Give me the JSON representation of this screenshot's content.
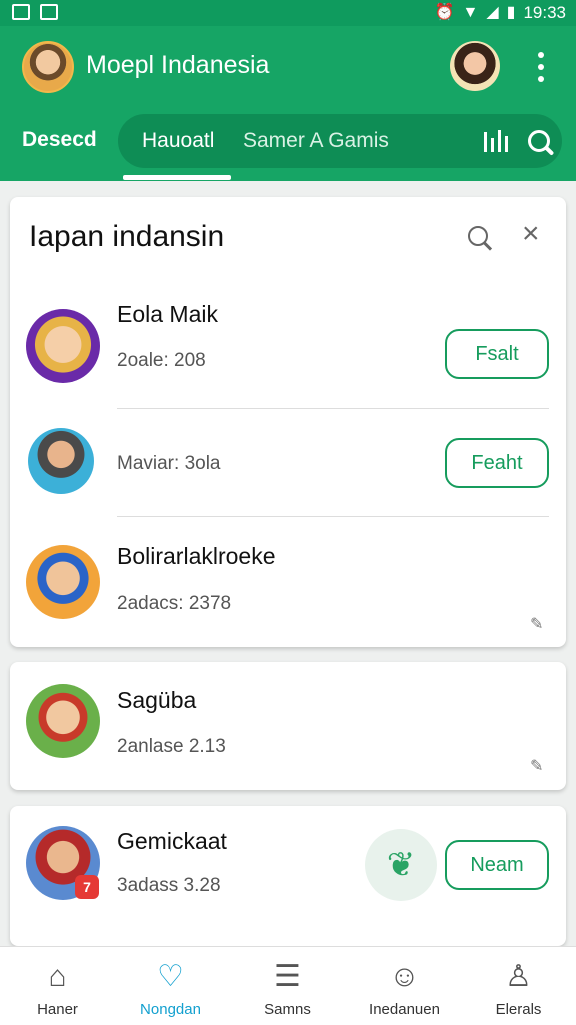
{
  "status_bar": {
    "time": "19:33"
  },
  "app_bar": {
    "title": "Moepl Indanesia",
    "tab_left": "Desecd",
    "tabs": [
      {
        "label": "Hauoatl"
      },
      {
        "label": "Samer A Gamis"
      }
    ]
  },
  "card": {
    "title": "Iapan indansin",
    "items": [
      {
        "name": "Eola Maik",
        "meta": "2oale: 208",
        "button": "Fsalt"
      },
      {
        "name": "",
        "meta": "Maviar: 3ola",
        "button": "Feaht"
      },
      {
        "name": "Bolirarlaklroeke",
        "meta": "2adacs: 2378",
        "button": ""
      }
    ]
  },
  "card2": {
    "name": "Sagüba",
    "meta": "2anlase 2.13"
  },
  "card3": {
    "name": "Gemickaat",
    "meta": "3adass 3.28",
    "badge": "7",
    "button": "Neam"
  },
  "bottom_nav": [
    {
      "label": "Haner",
      "icon": "home-icon"
    },
    {
      "label": "Nongdan",
      "icon": "heart-icon",
      "active": true
    },
    {
      "label": "Samns",
      "icon": "list-icon"
    },
    {
      "label": "Inedanuen",
      "icon": "face-icon"
    },
    {
      "label": "Elerals",
      "icon": "person-icon"
    }
  ],
  "colors": {
    "primary": "#16a565",
    "accent_nav": "#13a0cf",
    "button": "#169c5d",
    "badge": "#e53935"
  }
}
